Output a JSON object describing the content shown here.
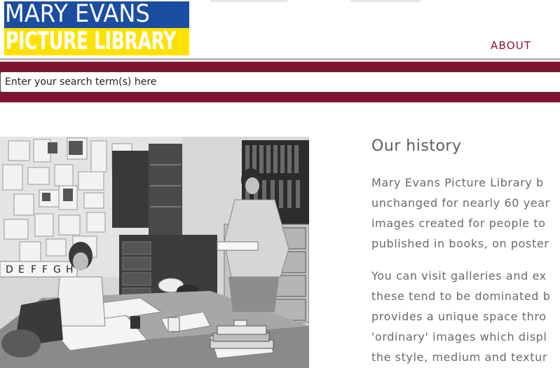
{
  "logo": {
    "line1": "MARY EVANS",
    "line2": "PICTURE LIBRARY",
    "colors": {
      "top": "#1b4da0",
      "bottom": "#ffe100",
      "text": "#ffffff"
    }
  },
  "nav": {
    "about": "ABOUT"
  },
  "search": {
    "placeholder": "Enter your search term(s) here"
  },
  "colors": {
    "accent": "#7f1330",
    "heading": "#5d5d5d",
    "body_text": "#6a6a6a"
  },
  "content": {
    "heading": "Our history",
    "paragraph1": [
      "Mary Evans Picture Library b",
      "unchanged for nearly 60 year",
      "images created for people to",
      "published in books, on poster"
    ],
    "paragraph2": [
      "You can visit galleries and ex",
      "these tend to be dominated b",
      "provides a unique space thro",
      "'ordinary' images which displ",
      "the style, medium and textur"
    ]
  },
  "photo": {
    "icon": "archive-office-photo",
    "drawer_labels": [
      "D",
      "E",
      "F",
      "F",
      "G",
      "H"
    ]
  }
}
